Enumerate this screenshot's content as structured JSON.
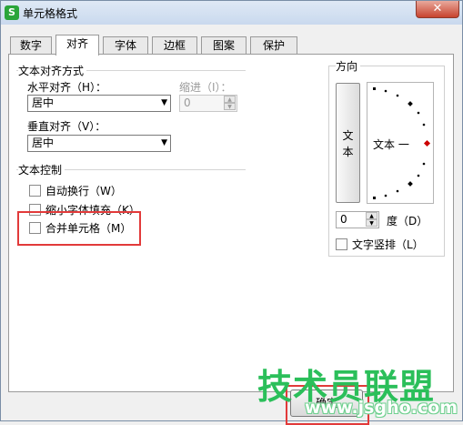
{
  "window": {
    "title": "单元格格式",
    "app_icon_letter": "S",
    "close_glyph": "✕"
  },
  "tabs": [
    "数字",
    "对齐",
    "字体",
    "边框",
    "图案",
    "保护"
  ],
  "active_tab": "对齐",
  "alignment": {
    "group_title": "文本对齐方式",
    "horizontal_label": "水平对齐（H）：",
    "horizontal_value": "居中",
    "indent_label": "缩进（I）：",
    "indent_value": "0",
    "vertical_label": "垂直对齐（V）：",
    "vertical_value": "居中"
  },
  "text_control": {
    "group_title": "文本控制",
    "wrap_label": "自动换行（W）",
    "shrink_label": "缩小字体填充（K）",
    "merge_label": "合并单元格（M）",
    "wrap_checked": false,
    "shrink_checked": false,
    "merge_checked": false
  },
  "orientation": {
    "group_title": "方向",
    "vertical_text_chars": [
      "文",
      "本"
    ],
    "dial_text": "文本 一",
    "degrees_value": "0",
    "degrees_label": "度（D）",
    "vertical_layout_label": "文字竖排（L）",
    "vertical_layout_checked": false,
    "indicator_color": "#cc0000"
  },
  "footer": {
    "ok_label": "确定"
  },
  "watermark": {
    "site_name": "技术员联盟",
    "url": "www.jsgho.com"
  },
  "colors": {
    "highlight": "#e23a3a",
    "watermark_green": "#2bbf5a"
  }
}
